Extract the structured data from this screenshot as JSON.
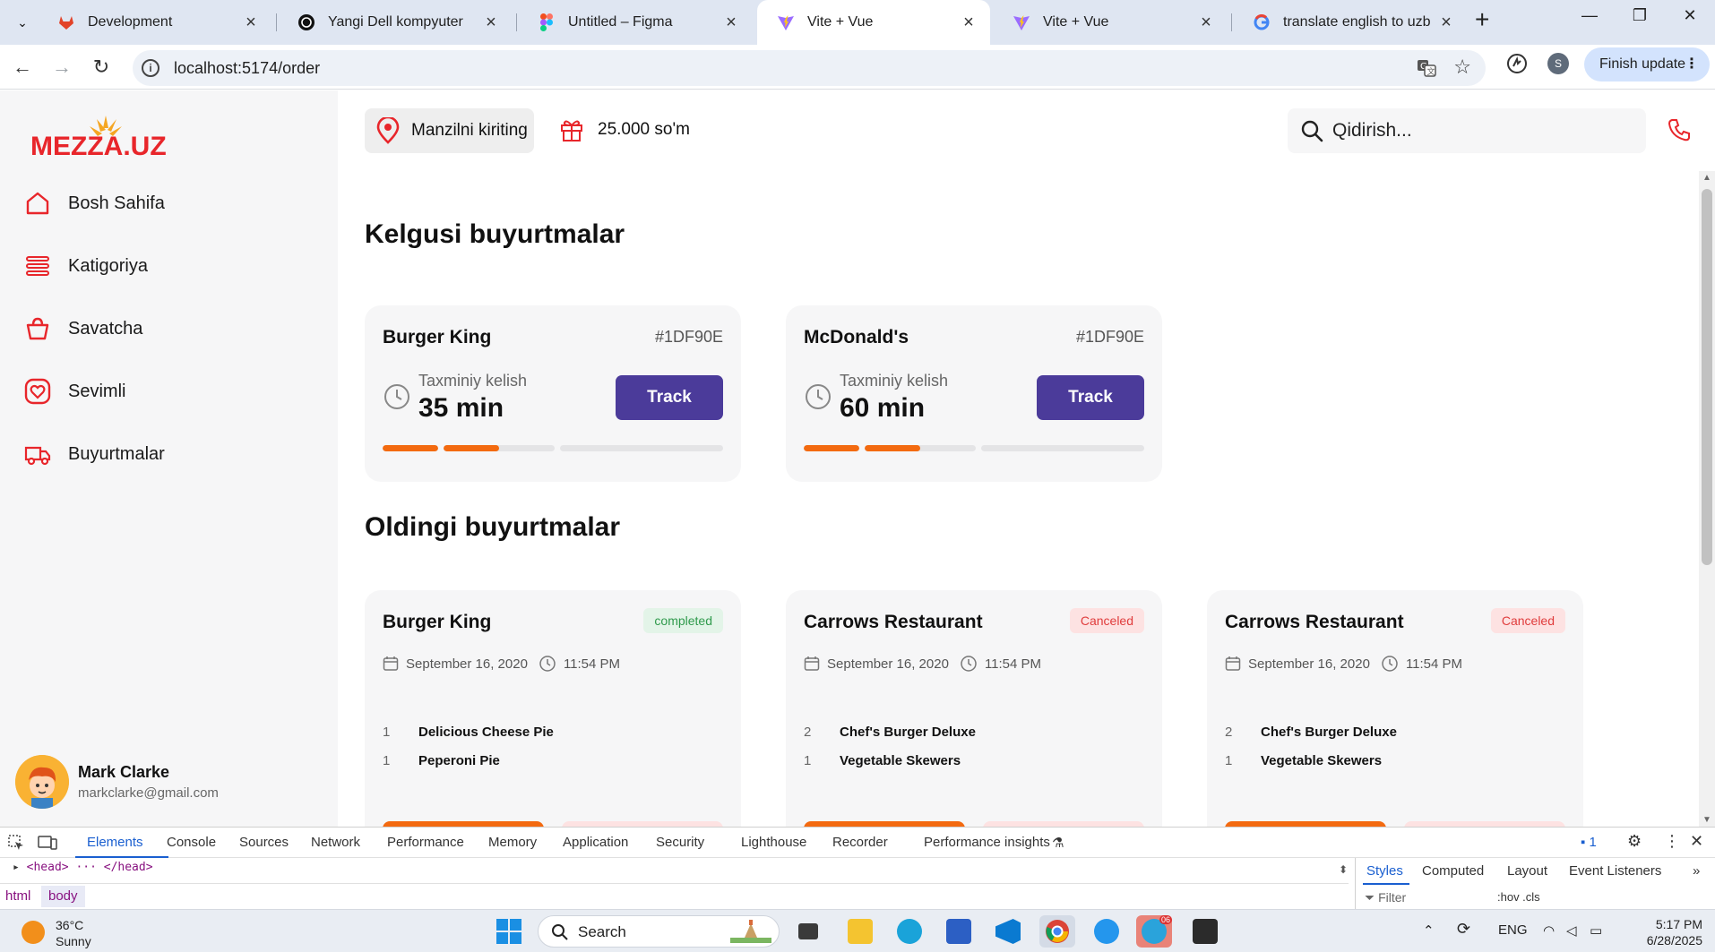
{
  "browser": {
    "tabs": [
      {
        "title": "Development",
        "favicon": "gitlab-icon"
      },
      {
        "title": "Yangi Dell kompyuter",
        "favicon": "chatgpt-icon"
      },
      {
        "title": "Untitled – Figma",
        "favicon": "figma-icon"
      },
      {
        "title": "Vite + Vue",
        "favicon": "vite-icon",
        "active": true
      },
      {
        "title": "Vite + Vue",
        "favicon": "vite-icon"
      },
      {
        "title": "translate english to uzbek",
        "favicon": "google-icon"
      }
    ],
    "url": "localhost:5174/order",
    "profile_letter": "S",
    "finish_update_label": "Finish update"
  },
  "app": {
    "logo_text": "MEZZA.UZ",
    "nav": [
      {
        "label": "Bosh Sahifa",
        "icon": "home-icon"
      },
      {
        "label": "Katigoriya",
        "icon": "list-icon"
      },
      {
        "label": "Savatcha",
        "icon": "basket-icon"
      },
      {
        "label": "Sevimli",
        "icon": "heart-icon"
      },
      {
        "label": "Buyurtmalar",
        "icon": "delivery-truck-icon"
      }
    ],
    "user": {
      "name": "Mark Clarke",
      "email": "markclarke@gmail.com"
    },
    "header": {
      "address_label": "Manzilni kiriting",
      "balance": "25.000 so'm",
      "search_placeholder": "Qidirish..."
    },
    "colors": {
      "accent": "#f36a10",
      "primary": "#4b3b9a",
      "icon_red": "#e8262b"
    },
    "upcoming": {
      "title": "Kelgusi buyurtmalar",
      "orders": [
        {
          "restaurant": "Burger King",
          "order_id": "#1DF90E",
          "eta_label": "Taxminiy kelish",
          "eta": "35 min",
          "button": "Track",
          "progress_segments": [
            1,
            1,
            0
          ]
        },
        {
          "restaurant": "McDonald's",
          "order_id": "#1DF90E",
          "eta_label": "Taxminiy kelish",
          "eta": "60 min",
          "button": "Track",
          "progress_segments": [
            1,
            1,
            0
          ]
        }
      ]
    },
    "previous": {
      "title": "Oldingi buyurtmalar",
      "orders": [
        {
          "restaurant": "Burger King",
          "status": "completed",
          "date": "September 16, 2020",
          "time": "11:54 PM",
          "items": [
            {
              "qty": "1",
              "name": "Delicious Cheese Pie"
            },
            {
              "qty": "1",
              "name": "Peperoni Pie"
            }
          ]
        },
        {
          "restaurant": "Carrows Restaurant",
          "status": "Canceled",
          "date": "September 16, 2020",
          "time": "11:54 PM",
          "items": [
            {
              "qty": "2",
              "name": "Chef's Burger Deluxe"
            },
            {
              "qty": "1",
              "name": "Vegetable Skewers"
            }
          ]
        },
        {
          "restaurant": "Carrows Restaurant",
          "status": "Canceled",
          "date": "September 16, 2020",
          "time": "11:54 PM",
          "items": [
            {
              "qty": "2",
              "name": "Chef's Burger Deluxe"
            },
            {
              "qty": "1",
              "name": "Vegetable Skewers"
            }
          ]
        }
      ]
    }
  },
  "devtools": {
    "tabs": [
      "Elements",
      "Console",
      "Sources",
      "Network",
      "Performance",
      "Memory",
      "Application",
      "Security",
      "Lighthouse",
      "Recorder",
      "Performance insights"
    ],
    "issues_count": "1",
    "code_line": "<head> ··· </head>",
    "breadcrumbs": [
      "html",
      "body"
    ],
    "side_tabs": [
      "Styles",
      "Computed",
      "Layout",
      "Event Listeners"
    ],
    "filter_placeholder": "Filter",
    "filter_toggles": ":hov .cls"
  },
  "taskbar": {
    "temperature": "36°C",
    "weather": "Sunny",
    "search_label": "Search",
    "language": "ENG",
    "time": "5:17 PM",
    "date": "6/28/2025",
    "telegram_badge": "06"
  }
}
